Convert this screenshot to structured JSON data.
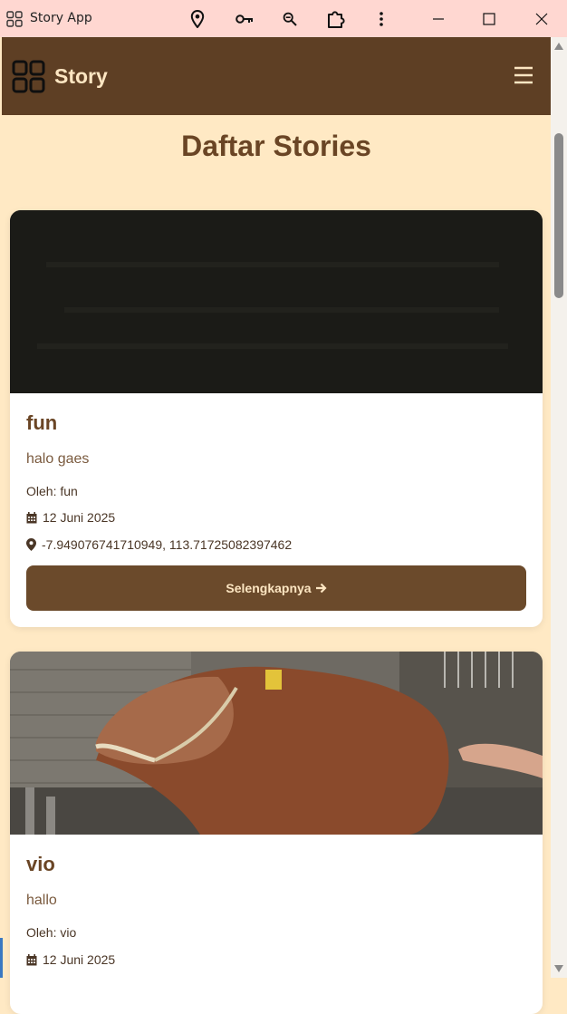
{
  "window": {
    "title": "Story App"
  },
  "appbar": {
    "brand": "Story"
  },
  "page": {
    "title": "Daftar Stories"
  },
  "stories": [
    {
      "title": "fun",
      "description": "halo gaes",
      "author": "Oleh: fun",
      "date": "12 Juni 2025",
      "location": "-7.949076741710949, 113.71725082397462",
      "button_label": "Selengkapnya"
    },
    {
      "title": "vio",
      "description": "hallo",
      "author": "Oleh: vio",
      "date": "12 Juni 2025"
    }
  ],
  "colors": {
    "titlebar": "#ffd7d1",
    "appbar": "#5e3f24",
    "background": "#ffe9c4",
    "accent": "#6b4a2b",
    "text": "#6a4525"
  }
}
